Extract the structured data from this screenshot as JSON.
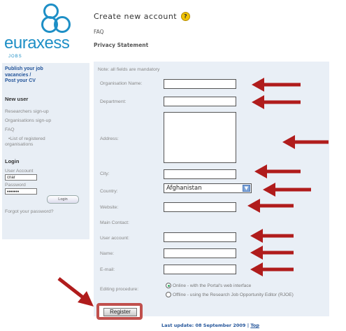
{
  "logo": {
    "word": "euraxess",
    "sub": "JOBS"
  },
  "header": {
    "title": "Create new account",
    "help_icon": "?",
    "faq": "FAQ",
    "privacy": "Privacy Statement"
  },
  "sidebar": {
    "publish": [
      "Publish your job",
      "vacancies /",
      "Post your CV"
    ],
    "new_user_heading": "New user",
    "links": [
      "Researchers sign-up",
      "Organisations sign-up",
      "FAQ"
    ],
    "registered_list": [
      "•List of registered",
      "organisations"
    ],
    "login_heading": "Login",
    "user_account_label": "User Account",
    "user_account_value": "cnar",
    "password_label": "Password",
    "password_value": "•••••••",
    "login_button": "Login",
    "forgot": "Forgot your password?"
  },
  "form": {
    "note": "Note: all fields are mandatory",
    "labels": {
      "organisation": "Organisation Name:",
      "department": "Department:",
      "address": "Address:",
      "city": "City:",
      "country": "Country:",
      "website": "Website:",
      "main_contact": "Main Contact:",
      "user_account": "User account:",
      "name": "Name:",
      "email": "E-mail:",
      "editing": "Editing procedure:"
    },
    "country_value": "Afghanistan",
    "radio_online": "Online - with the Portal's web interface",
    "radio_offline": "Offline - using the Research Job Opportunity Editor (RJOE)",
    "register_button": "Register"
  },
  "footer": {
    "text": "Last update: 08 September 2009 |",
    "top": "Top"
  },
  "colors": {
    "brand": "#1e8fc6",
    "arrow": "#b01c1c",
    "panel": "#e9eff6",
    "highlight": "#c0504d"
  }
}
